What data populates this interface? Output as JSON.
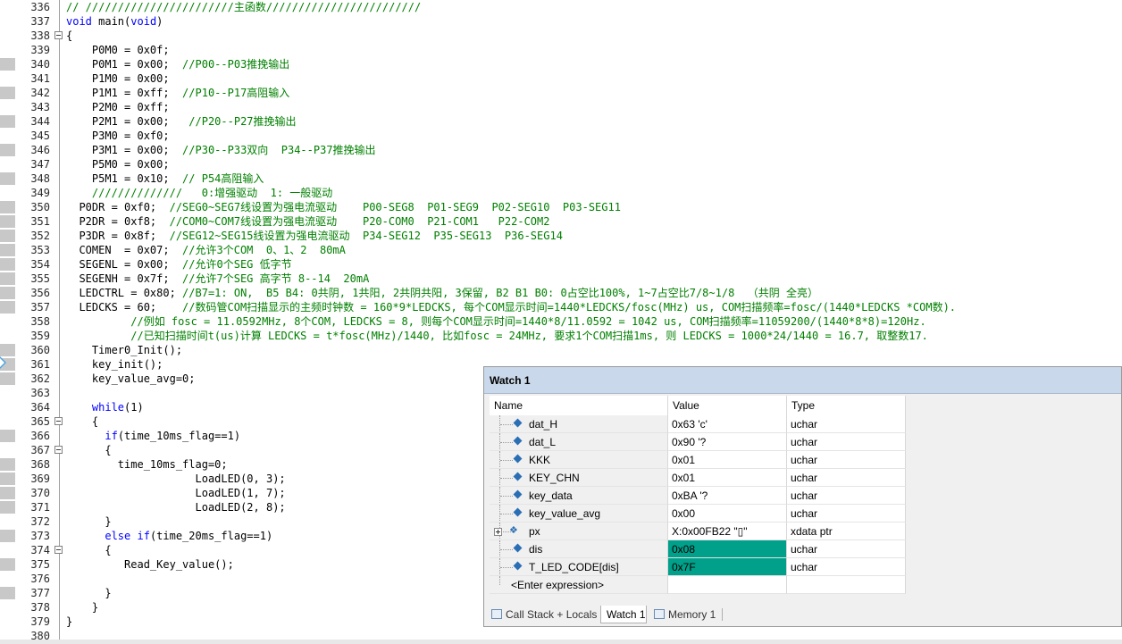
{
  "editor": {
    "lines": [
      {
        "n": "336",
        "segs": [
          [
            "cm",
            "// ///////////////////////主函数////////////////////////"
          ]
        ]
      },
      {
        "n": "337",
        "segs": [
          [
            "kw",
            "void"
          ],
          [
            "pl",
            " main("
          ],
          [
            "kw",
            "void"
          ],
          [
            "pl",
            ")"
          ]
        ]
      },
      {
        "n": "338",
        "fold": true,
        "segs": [
          [
            "pl",
            "{"
          ]
        ]
      },
      {
        "n": "339",
        "segs": [
          [
            "pl",
            "    P0M0 = 0x0f;"
          ]
        ]
      },
      {
        "n": "340",
        "mark": true,
        "segs": [
          [
            "pl",
            "    P0M1 = 0x00;  "
          ],
          [
            "cm",
            "//P00--P03推挽输出"
          ]
        ]
      },
      {
        "n": "341",
        "segs": [
          [
            "pl",
            "    P1M0 = 0x00;"
          ]
        ]
      },
      {
        "n": "342",
        "mark": true,
        "segs": [
          [
            "pl",
            "    P1M1 = 0xff;  "
          ],
          [
            "cm",
            "//P10--P17高阻输入"
          ]
        ]
      },
      {
        "n": "343",
        "segs": [
          [
            "pl",
            "    P2M0 = 0xff;"
          ]
        ]
      },
      {
        "n": "344",
        "mark": true,
        "segs": [
          [
            "pl",
            "    P2M1 = 0x00;   "
          ],
          [
            "cm",
            "//P20--P27推挽输出"
          ]
        ]
      },
      {
        "n": "345",
        "segs": [
          [
            "pl",
            "    P3M0 = 0xf0;"
          ]
        ]
      },
      {
        "n": "346",
        "mark": true,
        "segs": [
          [
            "pl",
            "    P3M1 = 0x00;  "
          ],
          [
            "cm",
            "//P30--P33双向  P34--P37推挽输出"
          ]
        ]
      },
      {
        "n": "347",
        "segs": [
          [
            "pl",
            "    P5M0 = 0x00;"
          ]
        ]
      },
      {
        "n": "348",
        "mark": true,
        "segs": [
          [
            "pl",
            "    P5M1 = 0x10;  "
          ],
          [
            "cm",
            "// P54高阻输入"
          ]
        ]
      },
      {
        "n": "349",
        "segs": [
          [
            "cm",
            "    //////////////   0:增强驱动  1: 一般驱动"
          ]
        ]
      },
      {
        "n": "350",
        "mark": true,
        "segs": [
          [
            "pl",
            "  P0DR = 0xf0;  "
          ],
          [
            "cm",
            "//SEG0~SEG7线设置为强电流驱动    P00-SEG8  P01-SEG9  P02-SEG10  P03-SEG11"
          ]
        ]
      },
      {
        "n": "351",
        "mark": true,
        "segs": [
          [
            "pl",
            "  P2DR = 0xf8;  "
          ],
          [
            "cm",
            "//COM0~COM7线设置为强电流驱动    P20-COM0  P21-COM1   P22-COM2"
          ]
        ]
      },
      {
        "n": "352",
        "mark": true,
        "segs": [
          [
            "pl",
            "  P3DR = 0x8f;  "
          ],
          [
            "cm",
            "//SEG12~SEG15线设置为强电流驱动  P34-SEG12  P35-SEG13  P36-SEG14"
          ]
        ]
      },
      {
        "n": "353",
        "mark": true,
        "segs": [
          [
            "pl",
            "  COMEN  = 0x07;  "
          ],
          [
            "cm",
            "//允许3个COM  0、1、2  80mA"
          ]
        ]
      },
      {
        "n": "354",
        "mark": true,
        "segs": [
          [
            "pl",
            "  SEGENL = 0x00;  "
          ],
          [
            "cm",
            "//允许0个SEG 低字节"
          ]
        ]
      },
      {
        "n": "355",
        "mark": true,
        "segs": [
          [
            "pl",
            "  SEGENH = 0x7f;  "
          ],
          [
            "cm",
            "//允许7个SEG 高字节 8--14  20mA"
          ]
        ]
      },
      {
        "n": "356",
        "mark": true,
        "segs": [
          [
            "pl",
            "  LEDCTRL = 0x80; "
          ],
          [
            "cm",
            "//B7=1: ON,  B5 B4: 0共阴, 1共阳, 2共阴共阳, 3保留, B2 B1 B0: 0占空比100%, 1~7占空比7/8~1/8  （共阴 全亮）"
          ]
        ]
      },
      {
        "n": "357",
        "mark": true,
        "segs": [
          [
            "pl",
            "  LEDCKS = 60;    "
          ],
          [
            "cm",
            "//数码管COM扫描显示的主频时钟数 = 160*9*LEDCKS, 每个COM显示时间=1440*LEDCKS/fosc(MHz) us, COM扫描频率=fosc/(1440*LEDCKS *COM数)."
          ]
        ]
      },
      {
        "n": "358",
        "segs": [
          [
            "cm",
            "          //例如 fosc = 11.0592MHz, 8个COM, LEDCKS = 8, 则每个COM显示时间=1440*8/11.0592 = 1042 us, COM扫描频率=11059200/(1440*8*8)=120Hz."
          ]
        ]
      },
      {
        "n": "359",
        "segs": [
          [
            "cm",
            "          //已知扫描时间t(us)计算 LEDCKS = t*fosc(MHz)/1440, 比如fosc = 24MHz, 要求1个COM扫描1ms, 则 LEDCKS = 1000*24/1440 = 16.7, 取整数17."
          ]
        ]
      },
      {
        "n": "360",
        "mark": true,
        "segs": [
          [
            "pl",
            "    Timer0_Init();"
          ]
        ]
      },
      {
        "n": "361",
        "mark": true,
        "segs": [
          [
            "pl",
            "    key_init();"
          ]
        ]
      },
      {
        "n": "362",
        "mark": true,
        "segs": [
          [
            "pl",
            "    key_value_avg=0;"
          ]
        ]
      },
      {
        "n": "363",
        "segs": [
          [
            "pl",
            ""
          ]
        ]
      },
      {
        "n": "364",
        "segs": [
          [
            "pl",
            "    "
          ],
          [
            "kw",
            "while"
          ],
          [
            "pl",
            "(1)"
          ]
        ]
      },
      {
        "n": "365",
        "fold": true,
        "segs": [
          [
            "pl",
            "    {"
          ]
        ]
      },
      {
        "n": "366",
        "mark": true,
        "segs": [
          [
            "pl",
            "      "
          ],
          [
            "kw",
            "if"
          ],
          [
            "pl",
            "(time_10ms_flag==1)"
          ]
        ]
      },
      {
        "n": "367",
        "fold": true,
        "segs": [
          [
            "pl",
            "      {"
          ]
        ]
      },
      {
        "n": "368",
        "mark": true,
        "segs": [
          [
            "pl",
            "        time_10ms_flag=0;"
          ]
        ]
      },
      {
        "n": "369",
        "mark": true,
        "segs": [
          [
            "pl",
            "                    LoadLED(0, 3);"
          ]
        ]
      },
      {
        "n": "370",
        "mark": true,
        "segs": [
          [
            "pl",
            "                    LoadLED(1, 7);"
          ]
        ]
      },
      {
        "n": "371",
        "mark": true,
        "segs": [
          [
            "pl",
            "                    LoadLED(2, 8);"
          ]
        ]
      },
      {
        "n": "372",
        "segs": [
          [
            "pl",
            "      }"
          ]
        ]
      },
      {
        "n": "373",
        "mark": true,
        "segs": [
          [
            "pl",
            "      "
          ],
          [
            "kw",
            "else if"
          ],
          [
            "pl",
            "(time_20ms_flag==1)"
          ]
        ]
      },
      {
        "n": "374",
        "fold": true,
        "segs": [
          [
            "pl",
            "      {"
          ]
        ]
      },
      {
        "n": "375",
        "mark": true,
        "segs": [
          [
            "pl",
            "         Read_Key_value();"
          ]
        ]
      },
      {
        "n": "376",
        "segs": [
          [
            "pl",
            ""
          ]
        ]
      },
      {
        "n": "377",
        "mark": true,
        "segs": [
          [
            "pl",
            "      }"
          ]
        ]
      },
      {
        "n": "378",
        "segs": [
          [
            "pl",
            "    }"
          ]
        ]
      },
      {
        "n": "379",
        "segs": [
          [
            "pl",
            "}"
          ]
        ]
      },
      {
        "n": "380",
        "segs": [
          [
            "pl",
            ""
          ]
        ]
      }
    ]
  },
  "watch": {
    "title": "Watch 1",
    "columns": {
      "name": "Name",
      "value": "Value",
      "type": "Type"
    },
    "rows": [
      {
        "name": "dat_H",
        "value": "0x63 'c'",
        "type": "uchar"
      },
      {
        "name": "dat_L",
        "value": "0x90 '?",
        "type": "uchar"
      },
      {
        "name": "KKK",
        "value": "0x01",
        "type": "uchar"
      },
      {
        "name": "KEY_CHN",
        "value": "0x01",
        "type": "uchar"
      },
      {
        "name": "key_data",
        "value": "0xBA '?",
        "type": "uchar"
      },
      {
        "name": "key_value_avg",
        "value": "0x00",
        "type": "uchar"
      },
      {
        "name": "px",
        "value": "X:0x00FB22 \"▯\"",
        "type": "xdata ptr",
        "expandable": true
      },
      {
        "name": "dis",
        "value": "0x08",
        "type": "uchar",
        "highlight": true
      },
      {
        "name": "T_LED_CODE[dis]",
        "value": "0x7F",
        "type": "uchar",
        "highlight": true
      }
    ],
    "enter_expression": "<Enter expression>",
    "tabs": {
      "call_stack": "Call Stack + Locals",
      "watch1": "Watch 1",
      "memory1": "Memory 1"
    }
  }
}
